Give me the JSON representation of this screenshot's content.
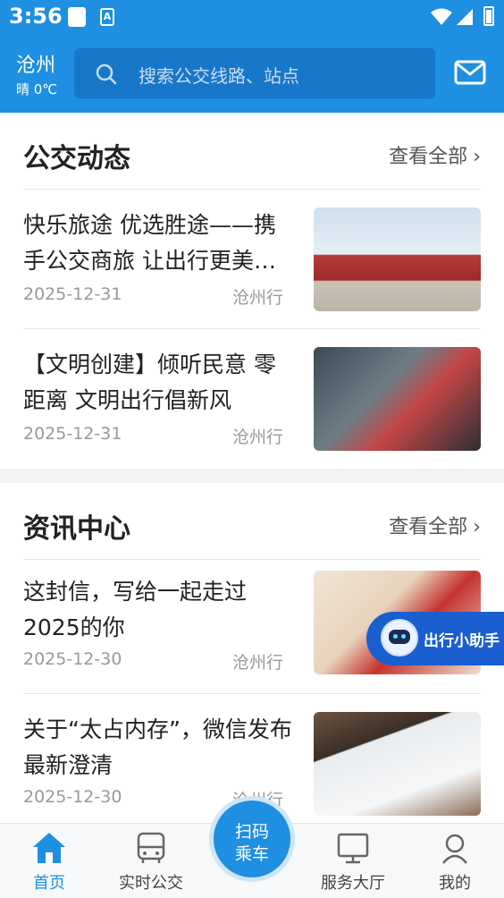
{
  "status_bar": {
    "time": "3:56",
    "app_badge": "A"
  },
  "header": {
    "city": "沧州",
    "weather": "晴 0℃",
    "search_placeholder": "搜索公交线路、站点"
  },
  "sections": [
    {
      "title": "公交动态",
      "see_all": "查看全部",
      "items": [
        {
          "title": "快乐旅途 优选胜途——携手公交商旅 让出行更美…",
          "date": "2025-12-31",
          "source": "沧州行"
        },
        {
          "title": "【文明创建】倾听民意 零距离 文明出行倡新风",
          "date": "2025-12-31",
          "source": "沧州行"
        }
      ]
    },
    {
      "title": "资讯中心",
      "see_all": "查看全部",
      "items": [
        {
          "title": "这封信，写给一起走过2025的你",
          "date": "2025-12-30",
          "source": "沧州行"
        },
        {
          "title": "关于“太占内存”，微信发布最新澄清",
          "date": "2025-12-30",
          "source": "沧州行"
        }
      ]
    }
  ],
  "assistant": {
    "label": "出行小助手"
  },
  "bottom_nav": {
    "home": "首页",
    "realtime": "实时公交",
    "scan_line1": "扫码",
    "scan_line2": "乘车",
    "service": "服务大厅",
    "mine": "我的"
  },
  "colors": {
    "primary": "#1e8fe1",
    "search_bg": "#1777c9",
    "assistant": "#1a5fcf"
  }
}
